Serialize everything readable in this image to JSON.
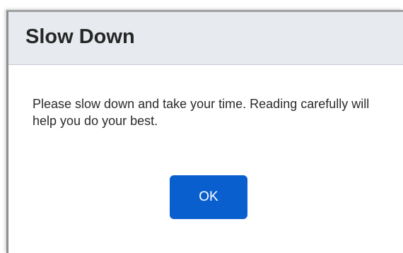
{
  "dialog": {
    "title": "Slow Down",
    "message": "Please slow down and take your time. Reading carefully will help you do your best.",
    "ok_label": "OK"
  },
  "colors": {
    "header_background": "#e7ebf0",
    "button_background": "#0a5fcf",
    "button_text": "#ffffff",
    "text": "#2b2b2b"
  }
}
